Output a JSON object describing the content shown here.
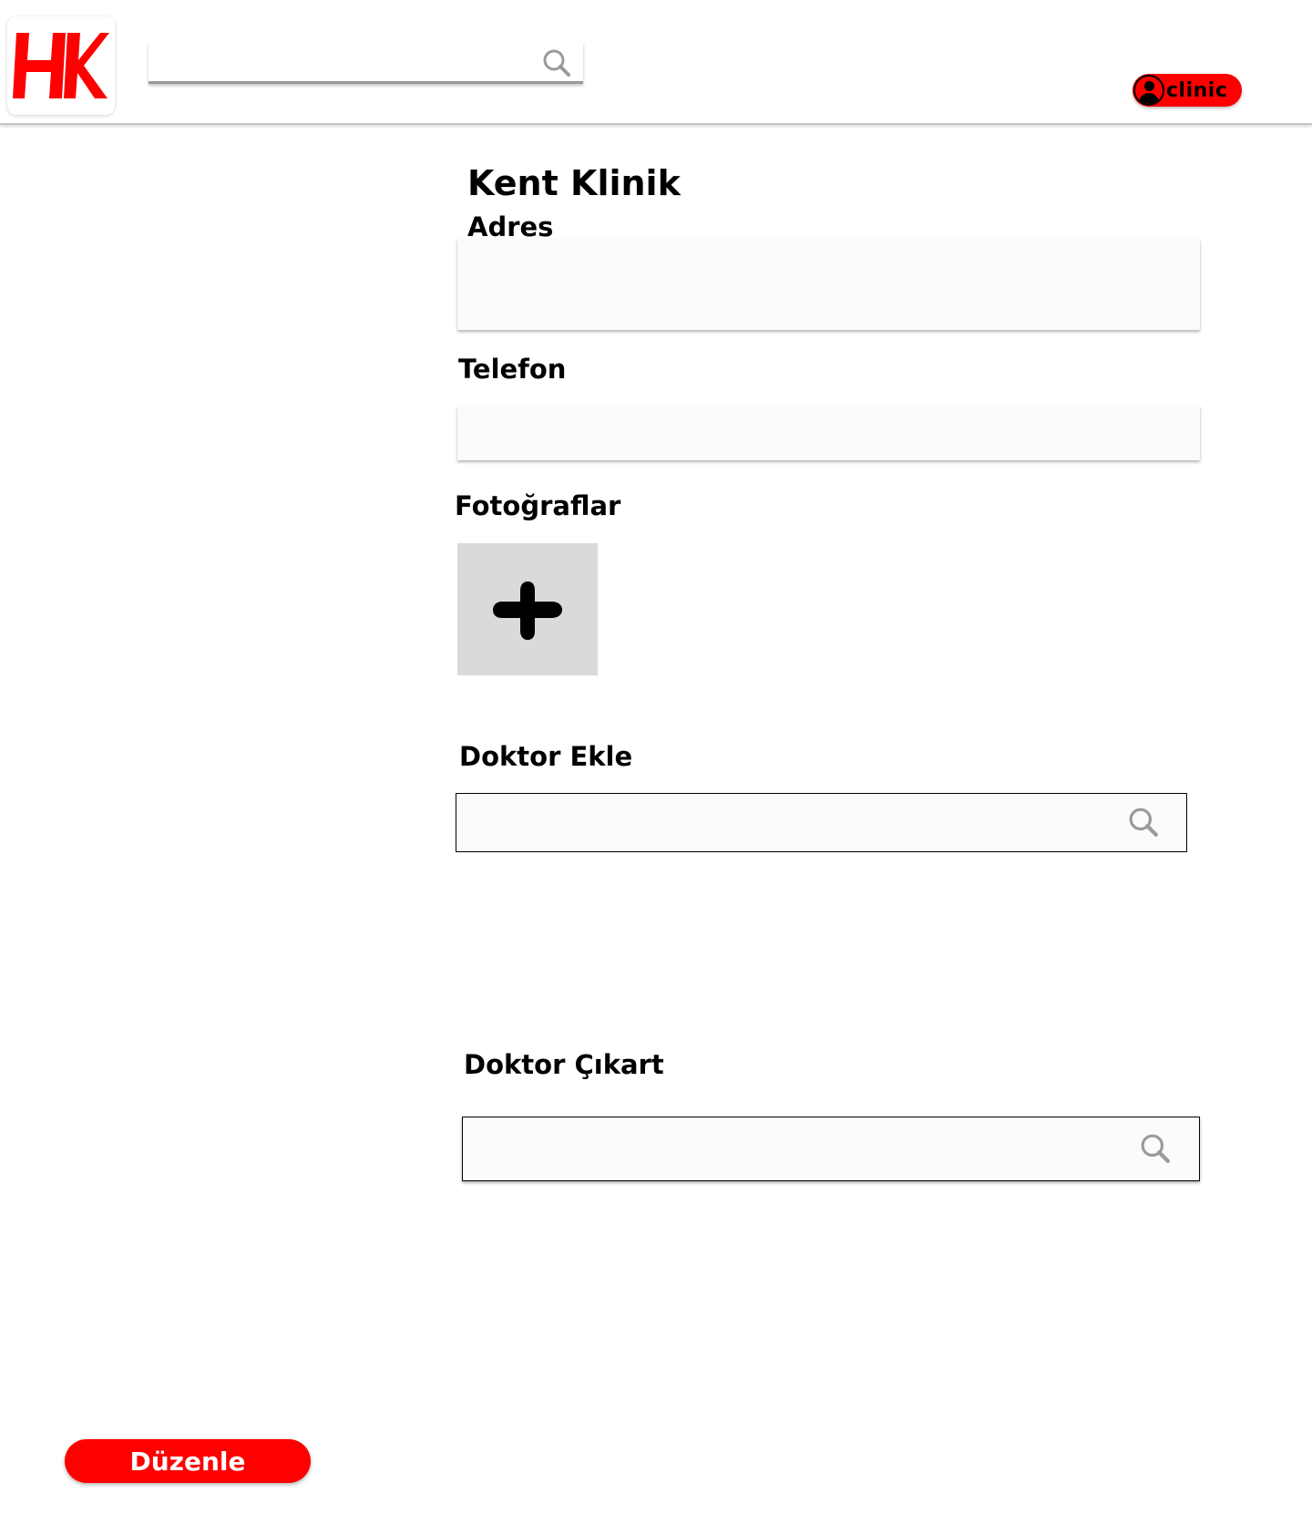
{
  "header": {
    "logo_text": "HK",
    "search": {
      "value": "",
      "placeholder": "",
      "icon": "search-icon"
    },
    "user": {
      "icon": "user-icon",
      "label": "clinic"
    }
  },
  "main": {
    "title": "Kent Klinik",
    "address": {
      "label": "Adres",
      "value": ""
    },
    "phone": {
      "label": "Telefon",
      "value": ""
    },
    "photos": {
      "label": "Fotoğraflar",
      "add_icon": "plus-icon"
    },
    "add_doctor": {
      "label": "Doktor Ekle",
      "value": "",
      "icon": "search-icon"
    },
    "remove_doctor": {
      "label": "Doktor Çıkart",
      "value": "",
      "icon": "search-icon"
    }
  },
  "actions": {
    "edit_label": "Düzenle"
  },
  "colors": {
    "brand_red": "#ff0000",
    "photo_tile": "#dadada",
    "icon_gray": "#9a9a9a"
  }
}
